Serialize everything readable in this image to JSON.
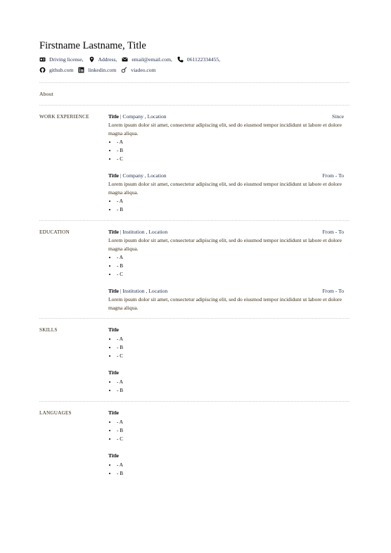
{
  "header": {
    "name": "Firstname Lastname, Title",
    "contacts": [
      {
        "icon": "id-card-icon",
        "label": "Driving license,"
      },
      {
        "icon": "map-pin-icon",
        "label": "Address,"
      },
      {
        "icon": "envelope-icon",
        "label": "email@email.com,"
      },
      {
        "icon": "phone-icon",
        "label": "061122334455,"
      }
    ],
    "links": [
      {
        "icon": "github-icon",
        "label": "github.com"
      },
      {
        "icon": "linkedin-icon",
        "label": "linkedin.com"
      },
      {
        "icon": "viadeo-icon",
        "label": "viadeo.com"
      }
    ]
  },
  "about": {
    "label": "About"
  },
  "work": {
    "label": "WORK EXPERIENCE",
    "entries": [
      {
        "title": "Title",
        "sep": " | ",
        "org": "Company , Location",
        "date": "Since",
        "desc": "Lorem ipsum dolor sit amet, consectetur adipiscing elit, sed do eiusmod tempor incididunt ut labore et dolore magna aliqua.",
        "items": [
          "- A",
          "- B",
          "- C"
        ]
      },
      {
        "title": "Title",
        "sep": " | ",
        "org": "Company , Location",
        "date": "From - To",
        "desc": "Lorem ipsum dolor sit amet, consectetur adipiscing elit, sed do eiusmod tempor incididunt ut labore et dolore magna aliqua.",
        "items": [
          "- A",
          "- B"
        ]
      }
    ]
  },
  "education": {
    "label": "EDUCATION",
    "entries": [
      {
        "title": "Title",
        "sep": " | ",
        "org": "Institution , Location",
        "date": "From - To",
        "desc": "Lorem ipsum dolor sit amet, consectetur adipiscing elit, sed do eiusmod tempor incididunt ut labore et dolore magna aliqua.",
        "items": [
          "- A",
          "- B",
          "- C"
        ]
      },
      {
        "title": "Title",
        "sep": " | ",
        "org": "Institution , Location",
        "date": "From - To",
        "desc": "Lorem ipsum dolor sit amet, consectetur adipiscing elit, sed do eiusmod tempor incididunt ut labore et dolore magna aliqua.",
        "items": []
      }
    ]
  },
  "skills": {
    "label": "SKILLS",
    "groups": [
      {
        "title": "Title",
        "items": [
          "- A",
          "- B",
          "- C"
        ]
      },
      {
        "title": "Title",
        "items": [
          "- A",
          "- B"
        ]
      }
    ]
  },
  "languages": {
    "label": "LANGUAGES",
    "groups": [
      {
        "title": "Title",
        "items": [
          "- A",
          "- B",
          "- C"
        ]
      },
      {
        "title": "Title",
        "items": [
          "- A",
          "- B"
        ]
      }
    ]
  }
}
